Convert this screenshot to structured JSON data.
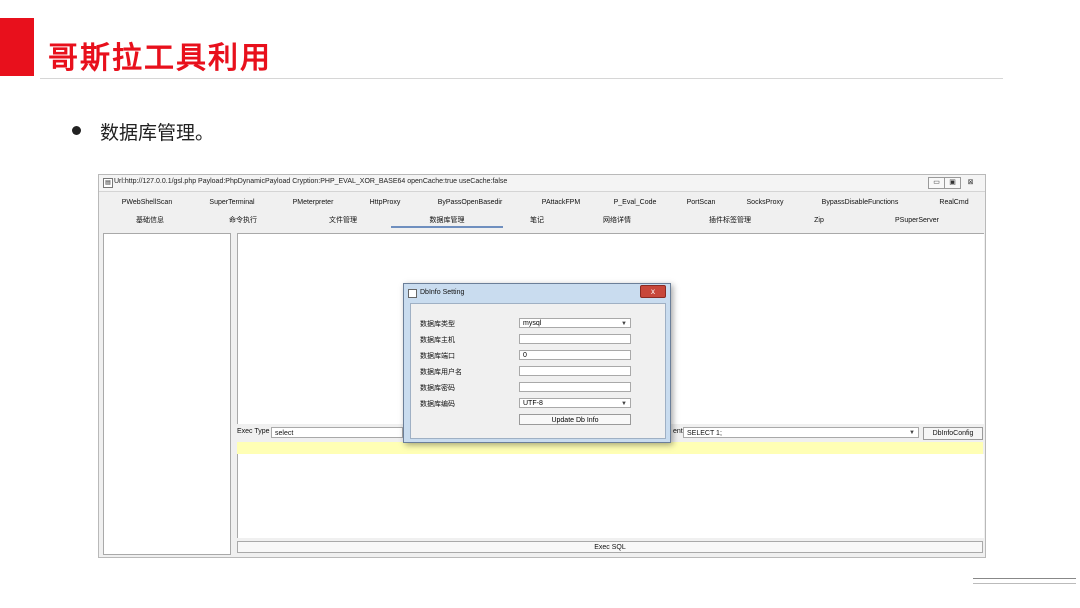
{
  "slide": {
    "title": "哥斯拉工具利用",
    "bullet": "数据库管理。",
    "accent_color": "#e8101c"
  },
  "window": {
    "title": "Url:http://127.0.0.1/gsl.php Payload:PhpDynamicPayload Cryption:PHP_EVAL_XOR_BASE64 openCache:true useCache:false",
    "controls": [
      "▭",
      "▣",
      "⊠"
    ],
    "tabs_row1": [
      "PWebShellScan",
      "SuperTerminal",
      "PMeterpreter",
      "HttpProxy",
      "ByPassOpenBasedir",
      "PAttackFPM",
      "P_Eval_Code",
      "PortScan",
      "SocksProxy",
      "BypassDisableFunctions",
      "RealCmd"
    ],
    "tabs_row2": [
      "基础信息",
      "命令执行",
      "文件管理",
      "数据库管理",
      "笔记",
      "网络详情",
      "插件标签管理",
      "Zip",
      "PSuperServer"
    ],
    "active_tab": "数据库管理",
    "exec_type_label": "Exec Type",
    "exec_type_value": "select",
    "sql_label": "ent",
    "sql_value": "SELECT 1;",
    "dbinfo_config_button": "DbInfoConfig",
    "exec_sql_button": "Exec SQL"
  },
  "dialog": {
    "title": "DbInfo Setting",
    "close": "x",
    "fields": [
      {
        "label": "数据库类型",
        "value": "mysql",
        "type": "select"
      },
      {
        "label": "数据库主机",
        "value": "",
        "type": "text"
      },
      {
        "label": "数据库端口",
        "value": "0",
        "type": "text"
      },
      {
        "label": "数据库用户名",
        "value": "",
        "type": "text"
      },
      {
        "label": "数据库密码",
        "value": "",
        "type": "text"
      },
      {
        "label": "数据库编码",
        "value": "UTF-8",
        "type": "select"
      }
    ],
    "update_button": "Update Db Info"
  }
}
